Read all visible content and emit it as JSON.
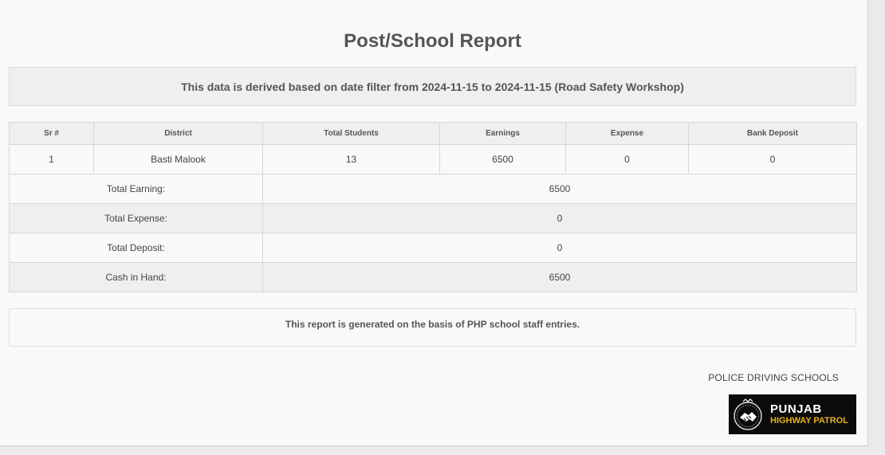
{
  "report": {
    "title": "Post/School Report",
    "filter_text": "This data is derived based on date filter from 2024-11-15 to 2024-11-15 (Road Safety Workshop)",
    "note_text": "This report is generated on the basis of PHP school staff entries."
  },
  "table": {
    "headers": [
      "Sr #",
      "District",
      "Total Students",
      "Earnings",
      "Expense",
      "Bank Deposit"
    ],
    "rows": [
      {
        "sr": "1",
        "district": "Basti Malook",
        "total_students": "13",
        "earnings": "6500",
        "expense": "0",
        "bank_deposit": "0"
      }
    ],
    "summary": [
      {
        "label": "Total Earning:",
        "value": "6500"
      },
      {
        "label": "Total Expense:",
        "value": "0"
      },
      {
        "label": "Total Deposit:",
        "value": "0"
      },
      {
        "label": "Cash in Hand:",
        "value": "6500"
      }
    ]
  },
  "footer": {
    "org_name": "POLICE DRIVING SCHOOLS",
    "logo_line1": "PUNJAB",
    "logo_line2": "HIGHWAY PATROL"
  },
  "colors": {
    "logo_background": "#0b0b0b",
    "logo_accent": "#e6b21e"
  }
}
